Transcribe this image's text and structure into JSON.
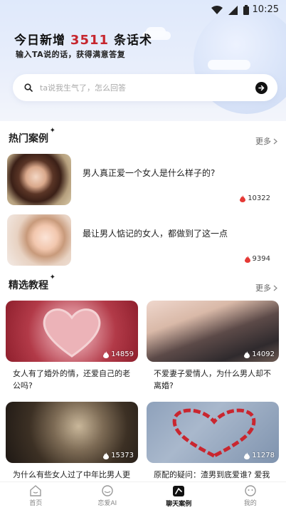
{
  "status": {
    "time": "10:25"
  },
  "hero": {
    "headline_prefix": "今日新增",
    "headline_count": "3511",
    "headline_suffix": "条话术",
    "subline": "输入TA说的话，获得满意答复"
  },
  "search": {
    "placeholder": "ta说我生气了，怎么回答"
  },
  "hot_cases": {
    "title": "热门案例",
    "more": "更多",
    "items": [
      {
        "title": "男人真正爱一个女人是什么样子的?",
        "count": "10322"
      },
      {
        "title": "最让男人惦记的女人，都做到了这一点",
        "count": "9394"
      }
    ]
  },
  "tutorials": {
    "title": "精选教程",
    "more": "更多",
    "items": [
      {
        "title": "女人有了婚外的情，还爱自己的老公吗?",
        "views": "14859"
      },
      {
        "title": "不爱妻子爱情人，为什么男人却不离婚?",
        "views": "14092"
      },
      {
        "title": "为什么有些女人过了中年比男人更",
        "views": "15373"
      },
      {
        "title": "原配的疑问：渣男到底爱谁? 爱我",
        "views": "11278"
      }
    ]
  },
  "tabs": [
    {
      "label": "首页"
    },
    {
      "label": "恋爱AI"
    },
    {
      "label": "聊天案例",
      "active": true
    },
    {
      "label": "我的"
    }
  ],
  "colors": {
    "accent_red": "#c6262e",
    "fire": "#e53935"
  }
}
